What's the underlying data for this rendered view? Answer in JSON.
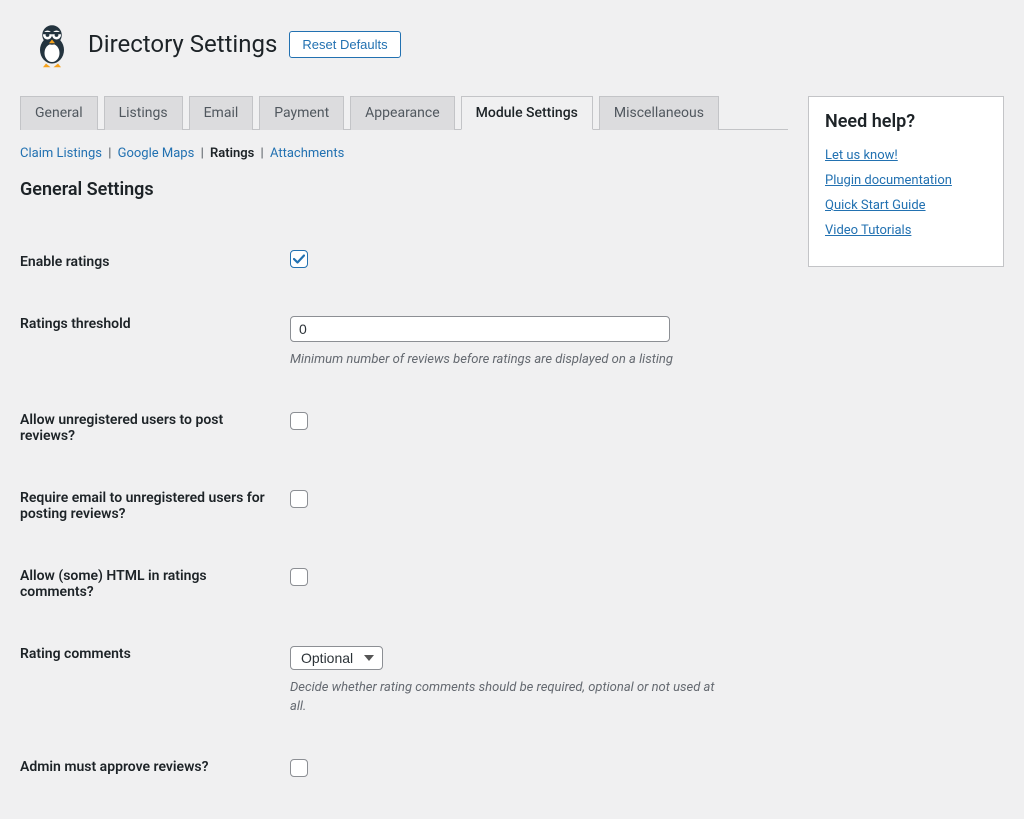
{
  "header": {
    "title": "Directory Settings",
    "reset_label": "Reset Defaults"
  },
  "tabs": [
    {
      "label": "General"
    },
    {
      "label": "Listings"
    },
    {
      "label": "Email"
    },
    {
      "label": "Payment"
    },
    {
      "label": "Appearance"
    },
    {
      "label": "Module Settings",
      "active": true
    },
    {
      "label": "Miscellaneous"
    }
  ],
  "subnav": {
    "items": [
      {
        "label": "Claim Listings",
        "current": false
      },
      {
        "label": "Google Maps",
        "current": false
      },
      {
        "label": "Ratings",
        "current": true
      },
      {
        "label": "Attachments",
        "current": false
      }
    ]
  },
  "section_title": "General Settings",
  "fields": {
    "enable_ratings": {
      "label": "Enable ratings",
      "checked": true
    },
    "threshold": {
      "label": "Ratings threshold",
      "value": "0",
      "desc": "Minimum number of reviews before ratings are displayed on a listing"
    },
    "allow_unreg": {
      "label": "Allow unregistered users to post reviews?",
      "checked": false
    },
    "require_email": {
      "label": "Require email to unregistered users for posting reviews?",
      "checked": false
    },
    "allow_html": {
      "label": "Allow (some) HTML in ratings comments?",
      "checked": false
    },
    "rating_comments": {
      "label": "Rating comments",
      "selected": "Optional",
      "desc": "Decide whether rating comments should be required, optional or not used at all."
    },
    "admin_approve": {
      "label": "Admin must approve reviews?",
      "checked": false
    }
  },
  "sidebar": {
    "title": "Need help?",
    "links": [
      "Let us know!",
      "Plugin documentation",
      "Quick Start Guide",
      "Video Tutorials"
    ]
  }
}
